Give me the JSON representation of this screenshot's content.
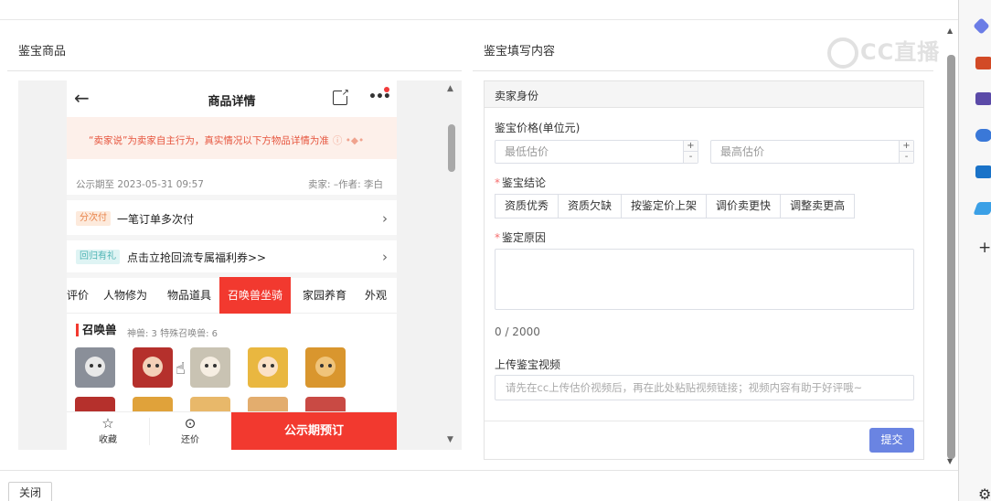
{
  "left_section": {
    "title": "鉴宝商品"
  },
  "right_section": {
    "title": "鉴宝填写内容"
  },
  "phone": {
    "header_title": "商品详情",
    "notice": "“卖家说”为卖家自主行为，真实情况以下方物品详情为准",
    "publicity_until": "公示期至 2023-05-31 09:57",
    "seller": "卖家: –作者: 李白",
    "rows": [
      {
        "tag": "分次付",
        "text": "一笔订单多次付"
      },
      {
        "tag": "回归有礼",
        "text": "点击立抢回流专属福利券>>"
      }
    ],
    "tabs": [
      "评价",
      "人物修为",
      "物品道具",
      "召唤兽坐骑",
      "家园养育",
      "外观"
    ],
    "pets_title": "召唤兽",
    "pets_sub": "神兽: 3   特殊召唤兽: 6",
    "bottom": {
      "favorite": "收藏",
      "bargain": "还价",
      "cta": "公示期预订"
    }
  },
  "form": {
    "card_title": "卖家身份",
    "price_label": "鉴宝价格(单位元)",
    "min_placeholder": "最低估价",
    "max_placeholder": "最高估价",
    "conclusion_label": "鉴宝结论",
    "conclusions": [
      "资质优秀",
      "资质欠缺",
      "按鉴定价上架",
      "调价卖更快",
      "调整卖更高"
    ],
    "reason_label": "鉴定原因",
    "reason_count": "0 / 2000",
    "video_label": "上传鉴宝视频",
    "video_placeholder": "请先在cc上传估价视频后，再在此处粘贴视频链接；视频内容有助于好评哦~",
    "submit": "提交"
  },
  "watermark": "CC直播",
  "footer": {
    "close": "关闭"
  },
  "colors": {
    "accent_red": "#f2392f",
    "submit_blue": "#6a84e2"
  }
}
